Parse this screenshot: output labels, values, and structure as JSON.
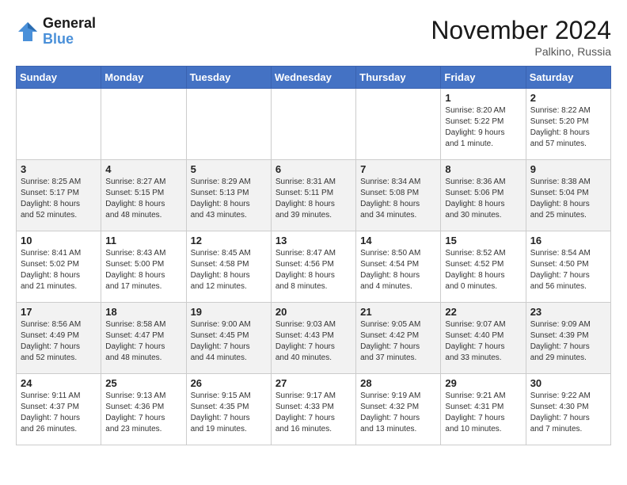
{
  "header": {
    "logo_line1": "General",
    "logo_line2": "Blue",
    "month_title": "November 2024",
    "location": "Palkino, Russia"
  },
  "days_of_week": [
    "Sunday",
    "Monday",
    "Tuesday",
    "Wednesday",
    "Thursday",
    "Friday",
    "Saturday"
  ],
  "weeks": [
    [
      {
        "day": "",
        "info": ""
      },
      {
        "day": "",
        "info": ""
      },
      {
        "day": "",
        "info": ""
      },
      {
        "day": "",
        "info": ""
      },
      {
        "day": "",
        "info": ""
      },
      {
        "day": "1",
        "info": "Sunrise: 8:20 AM\nSunset: 5:22 PM\nDaylight: 9 hours\nand 1 minute."
      },
      {
        "day": "2",
        "info": "Sunrise: 8:22 AM\nSunset: 5:20 PM\nDaylight: 8 hours\nand 57 minutes."
      }
    ],
    [
      {
        "day": "3",
        "info": "Sunrise: 8:25 AM\nSunset: 5:17 PM\nDaylight: 8 hours\nand 52 minutes."
      },
      {
        "day": "4",
        "info": "Sunrise: 8:27 AM\nSunset: 5:15 PM\nDaylight: 8 hours\nand 48 minutes."
      },
      {
        "day": "5",
        "info": "Sunrise: 8:29 AM\nSunset: 5:13 PM\nDaylight: 8 hours\nand 43 minutes."
      },
      {
        "day": "6",
        "info": "Sunrise: 8:31 AM\nSunset: 5:11 PM\nDaylight: 8 hours\nand 39 minutes."
      },
      {
        "day": "7",
        "info": "Sunrise: 8:34 AM\nSunset: 5:08 PM\nDaylight: 8 hours\nand 34 minutes."
      },
      {
        "day": "8",
        "info": "Sunrise: 8:36 AM\nSunset: 5:06 PM\nDaylight: 8 hours\nand 30 minutes."
      },
      {
        "day": "9",
        "info": "Sunrise: 8:38 AM\nSunset: 5:04 PM\nDaylight: 8 hours\nand 25 minutes."
      }
    ],
    [
      {
        "day": "10",
        "info": "Sunrise: 8:41 AM\nSunset: 5:02 PM\nDaylight: 8 hours\nand 21 minutes."
      },
      {
        "day": "11",
        "info": "Sunrise: 8:43 AM\nSunset: 5:00 PM\nDaylight: 8 hours\nand 17 minutes."
      },
      {
        "day": "12",
        "info": "Sunrise: 8:45 AM\nSunset: 4:58 PM\nDaylight: 8 hours\nand 12 minutes."
      },
      {
        "day": "13",
        "info": "Sunrise: 8:47 AM\nSunset: 4:56 PM\nDaylight: 8 hours\nand 8 minutes."
      },
      {
        "day": "14",
        "info": "Sunrise: 8:50 AM\nSunset: 4:54 PM\nDaylight: 8 hours\nand 4 minutes."
      },
      {
        "day": "15",
        "info": "Sunrise: 8:52 AM\nSunset: 4:52 PM\nDaylight: 8 hours\nand 0 minutes."
      },
      {
        "day": "16",
        "info": "Sunrise: 8:54 AM\nSunset: 4:50 PM\nDaylight: 7 hours\nand 56 minutes."
      }
    ],
    [
      {
        "day": "17",
        "info": "Sunrise: 8:56 AM\nSunset: 4:49 PM\nDaylight: 7 hours\nand 52 minutes."
      },
      {
        "day": "18",
        "info": "Sunrise: 8:58 AM\nSunset: 4:47 PM\nDaylight: 7 hours\nand 48 minutes."
      },
      {
        "day": "19",
        "info": "Sunrise: 9:00 AM\nSunset: 4:45 PM\nDaylight: 7 hours\nand 44 minutes."
      },
      {
        "day": "20",
        "info": "Sunrise: 9:03 AM\nSunset: 4:43 PM\nDaylight: 7 hours\nand 40 minutes."
      },
      {
        "day": "21",
        "info": "Sunrise: 9:05 AM\nSunset: 4:42 PM\nDaylight: 7 hours\nand 37 minutes."
      },
      {
        "day": "22",
        "info": "Sunrise: 9:07 AM\nSunset: 4:40 PM\nDaylight: 7 hours\nand 33 minutes."
      },
      {
        "day": "23",
        "info": "Sunrise: 9:09 AM\nSunset: 4:39 PM\nDaylight: 7 hours\nand 29 minutes."
      }
    ],
    [
      {
        "day": "24",
        "info": "Sunrise: 9:11 AM\nSunset: 4:37 PM\nDaylight: 7 hours\nand 26 minutes."
      },
      {
        "day": "25",
        "info": "Sunrise: 9:13 AM\nSunset: 4:36 PM\nDaylight: 7 hours\nand 23 minutes."
      },
      {
        "day": "26",
        "info": "Sunrise: 9:15 AM\nSunset: 4:35 PM\nDaylight: 7 hours\nand 19 minutes."
      },
      {
        "day": "27",
        "info": "Sunrise: 9:17 AM\nSunset: 4:33 PM\nDaylight: 7 hours\nand 16 minutes."
      },
      {
        "day": "28",
        "info": "Sunrise: 9:19 AM\nSunset: 4:32 PM\nDaylight: 7 hours\nand 13 minutes."
      },
      {
        "day": "29",
        "info": "Sunrise: 9:21 AM\nSunset: 4:31 PM\nDaylight: 7 hours\nand 10 minutes."
      },
      {
        "day": "30",
        "info": "Sunrise: 9:22 AM\nSunset: 4:30 PM\nDaylight: 7 hours\nand 7 minutes."
      }
    ]
  ]
}
